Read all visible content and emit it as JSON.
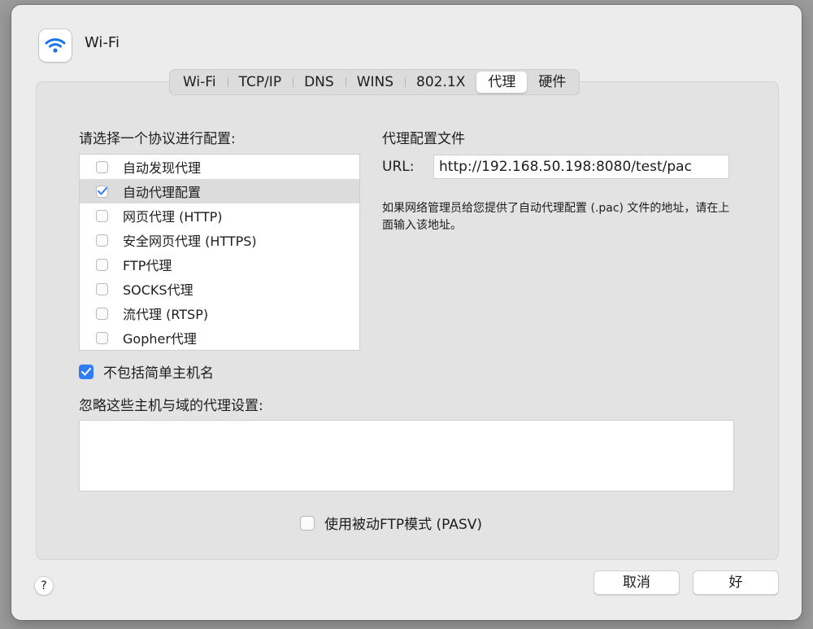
{
  "window": {
    "title": "Wi-Fi"
  },
  "tabs": [
    {
      "label": "Wi-Fi"
    },
    {
      "label": "TCP/IP"
    },
    {
      "label": "DNS"
    },
    {
      "label": "WINS"
    },
    {
      "label": "802.1X"
    },
    {
      "label": "代理",
      "active": true
    },
    {
      "label": "硬件"
    }
  ],
  "protocols": {
    "heading": "请选择一个协议进行配置:",
    "items": [
      {
        "label": "自动发现代理",
        "checked": false
      },
      {
        "label": "自动代理配置",
        "checked": true
      },
      {
        "label": "网页代理 (HTTP)",
        "checked": false
      },
      {
        "label": "安全网页代理 (HTTPS)",
        "checked": false
      },
      {
        "label": "FTP代理",
        "checked": false
      },
      {
        "label": "SOCKS代理",
        "checked": false
      },
      {
        "label": "流代理 (RTSP)",
        "checked": false
      },
      {
        "label": "Gopher代理",
        "checked": false
      }
    ]
  },
  "config": {
    "heading": "代理配置文件",
    "url_label": "URL:",
    "url_value": "http://192.168.50.198:8080/test/pac",
    "description": "如果网络管理员给您提供了自动代理配置 (.pac) 文件的地址，请在上面输入该地址。"
  },
  "options": {
    "exclude_simple_label": "不包括简单主机名",
    "exclude_simple_checked": true,
    "bypass_heading": "忽略这些主机与域的代理设置:",
    "bypass_value": "",
    "pasv_label": "使用被动FTP模式 (PASV)",
    "pasv_checked": false
  },
  "footer": {
    "help": "?",
    "cancel_label": "取消",
    "ok_label": "好"
  },
  "colors": {
    "accent": "#2f7cf6"
  }
}
